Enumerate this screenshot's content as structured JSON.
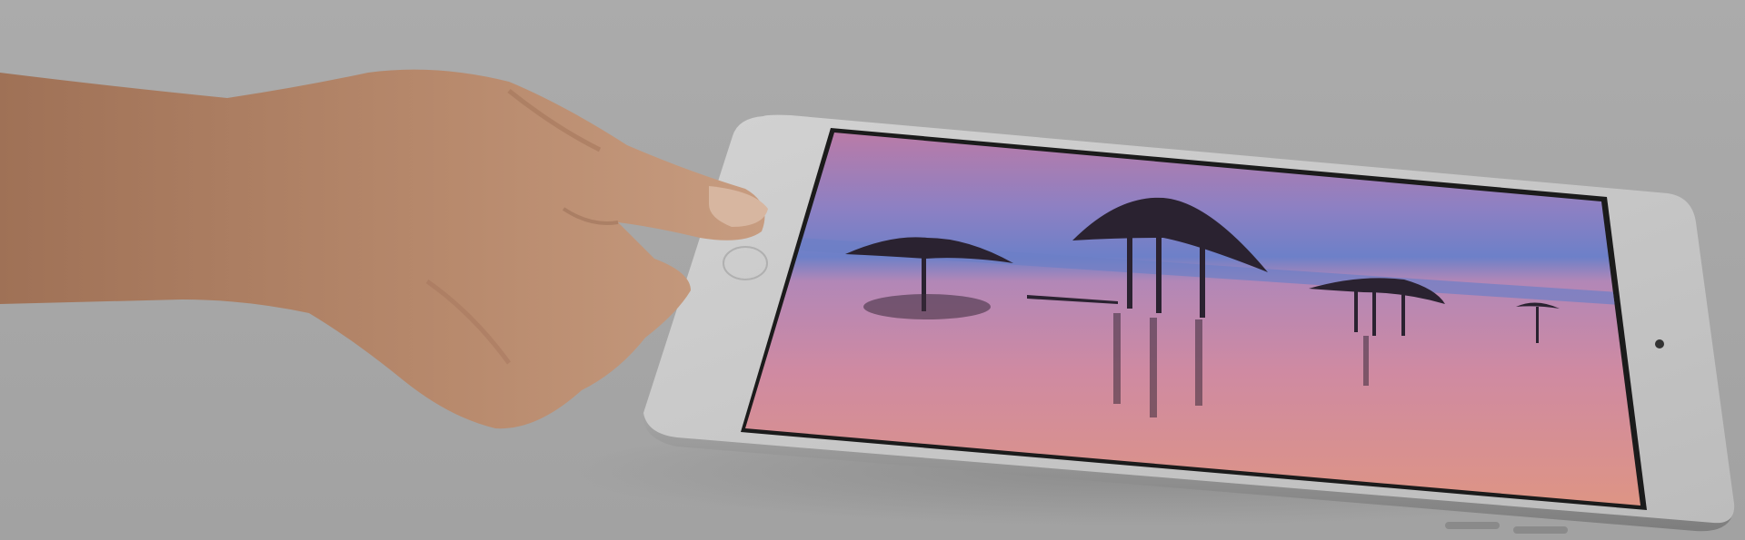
{
  "scene": {
    "subject": "tablet-held-by-hand",
    "colors": {
      "background": "#a9a9a9",
      "device_body": "#c8c8c8",
      "device_edge": "#8f8f8f",
      "screen_bezel": "#1b1b1b",
      "sky_top": "#c17aa0",
      "sky_mid": "#7d7fc8",
      "water": "#d48c9a",
      "water_low": "#e0947e",
      "skin": "#b98a6c"
    }
  }
}
